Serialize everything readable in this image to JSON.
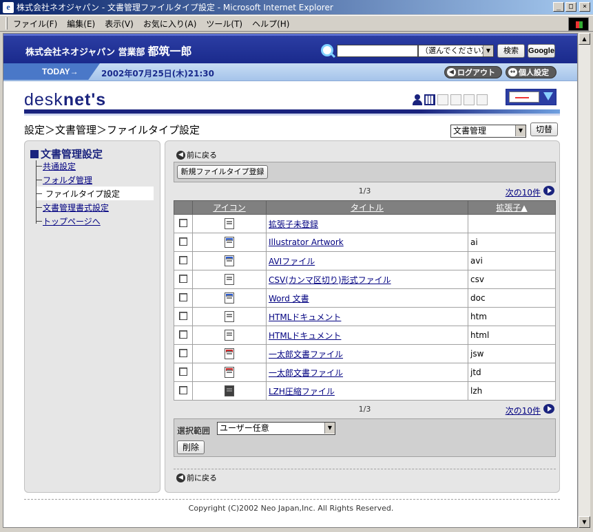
{
  "window": {
    "title": "株式会社ネオジャパン - 文書管理ファイルタイプ設定 - Microsoft Internet Explorer",
    "menus": [
      "ファイル(F)",
      "編集(E)",
      "表示(V)",
      "お気に入り(A)",
      "ツール(T)",
      "ヘルプ(H)"
    ]
  },
  "header": {
    "company": "株式会社ネオジャパン 営業部",
    "user": "都筑一郎",
    "search_value": "",
    "search_scope": "（選んでください）",
    "search_button": "検索",
    "google_button": "Google"
  },
  "todaybar": {
    "label": "TODAY→",
    "date": "2002年07月25日(木)21:30",
    "logout": "ログアウト",
    "personal": "個人設定"
  },
  "logo": {
    "thin": "desk",
    "bold": "net's"
  },
  "breadcrumb": "設定＞文書管理＞ファイルタイプ設定",
  "module_select": "文書管理",
  "switch_button": "切替",
  "sidebar": {
    "title": "文書管理設定",
    "items": [
      {
        "label": "共通設定",
        "link": true
      },
      {
        "label": "フォルダ管理",
        "link": true
      },
      {
        "label": "ファイルタイプ設定",
        "link": false
      },
      {
        "label": "文書管理書式設定",
        "link": true
      },
      {
        "label": "トップページへ",
        "link": true
      }
    ]
  },
  "main": {
    "back_label": "前に戻る",
    "new_button": "新規ファイルタイプ登録",
    "page_indicator": "1/3",
    "next_label": "次の10件",
    "columns": [
      "アイコン",
      "タイトル",
      "拡張子▲"
    ],
    "rows": [
      {
        "title": "拡張子未登録",
        "ext": ""
      },
      {
        "title": "Illustrator Artwork",
        "ext": "ai"
      },
      {
        "title": "AVIファイル",
        "ext": "avi"
      },
      {
        "title": "CSV(カンマ区切り)形式ファイル",
        "ext": "csv"
      },
      {
        "title": "Word 文書",
        "ext": "doc"
      },
      {
        "title": "HTMLドキュメント",
        "ext": "htm"
      },
      {
        "title": "HTMLドキュメント",
        "ext": "html"
      },
      {
        "title": "一太郎文書ファイル",
        "ext": "jsw"
      },
      {
        "title": "一太郎文書ファイル",
        "ext": "jtd"
      },
      {
        "title": "LZH圧縮ファイル",
        "ext": "lzh"
      }
    ],
    "range_label": "選択範囲",
    "range_value": "ユーザー任意",
    "delete_button": "削除"
  },
  "footer": {
    "copyright": "Copyright (C)2002 Neo Japan,Inc. All Rights Reserved."
  }
}
